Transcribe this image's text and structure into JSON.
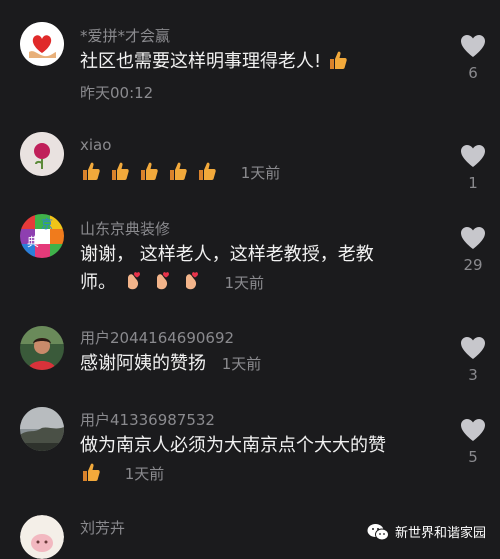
{
  "comments": [
    {
      "user": "*爱拼*才会赢",
      "text": "社区也需要这样明事理得老人!",
      "text_emoji": [
        "thumbs-up"
      ],
      "time": "昨天00:12",
      "likes": "6"
    },
    {
      "user": "xiao",
      "text": "",
      "text_emoji": [
        "thumbs-up",
        "thumbs-up",
        "thumbs-up",
        "thumbs-up",
        "thumbs-up"
      ],
      "time": "1天前",
      "likes": "1"
    },
    {
      "user": "山东京典装修",
      "text_line1": "谢谢， 这样老人，这样老教授，老教",
      "text_line2": "师。",
      "text_emoji": [
        "finger-heart",
        "finger-heart",
        "finger-heart"
      ],
      "time": "1天前",
      "likes": "29",
      "avatar_chars": [
        "京",
        "典"
      ]
    },
    {
      "user": "用户2044164690692",
      "text": "感谢阿姨的赞扬",
      "time": "1天前",
      "likes": "3"
    },
    {
      "user": "用户41336987532",
      "text": "做为南京人必须为大南京点个大大的赞",
      "text_emoji": [
        "thumbs-up"
      ],
      "time": "1天前",
      "likes": "5"
    },
    {
      "user": "刘芳卉"
    }
  ],
  "watermark": {
    "label": "新世界和谐家园",
    "icon": "wechat-icon"
  },
  "colors": {
    "background": "#1b1b1d",
    "username": "#8a8a8e",
    "text": "#f1f1f1",
    "heart": "#c7c7cc"
  }
}
